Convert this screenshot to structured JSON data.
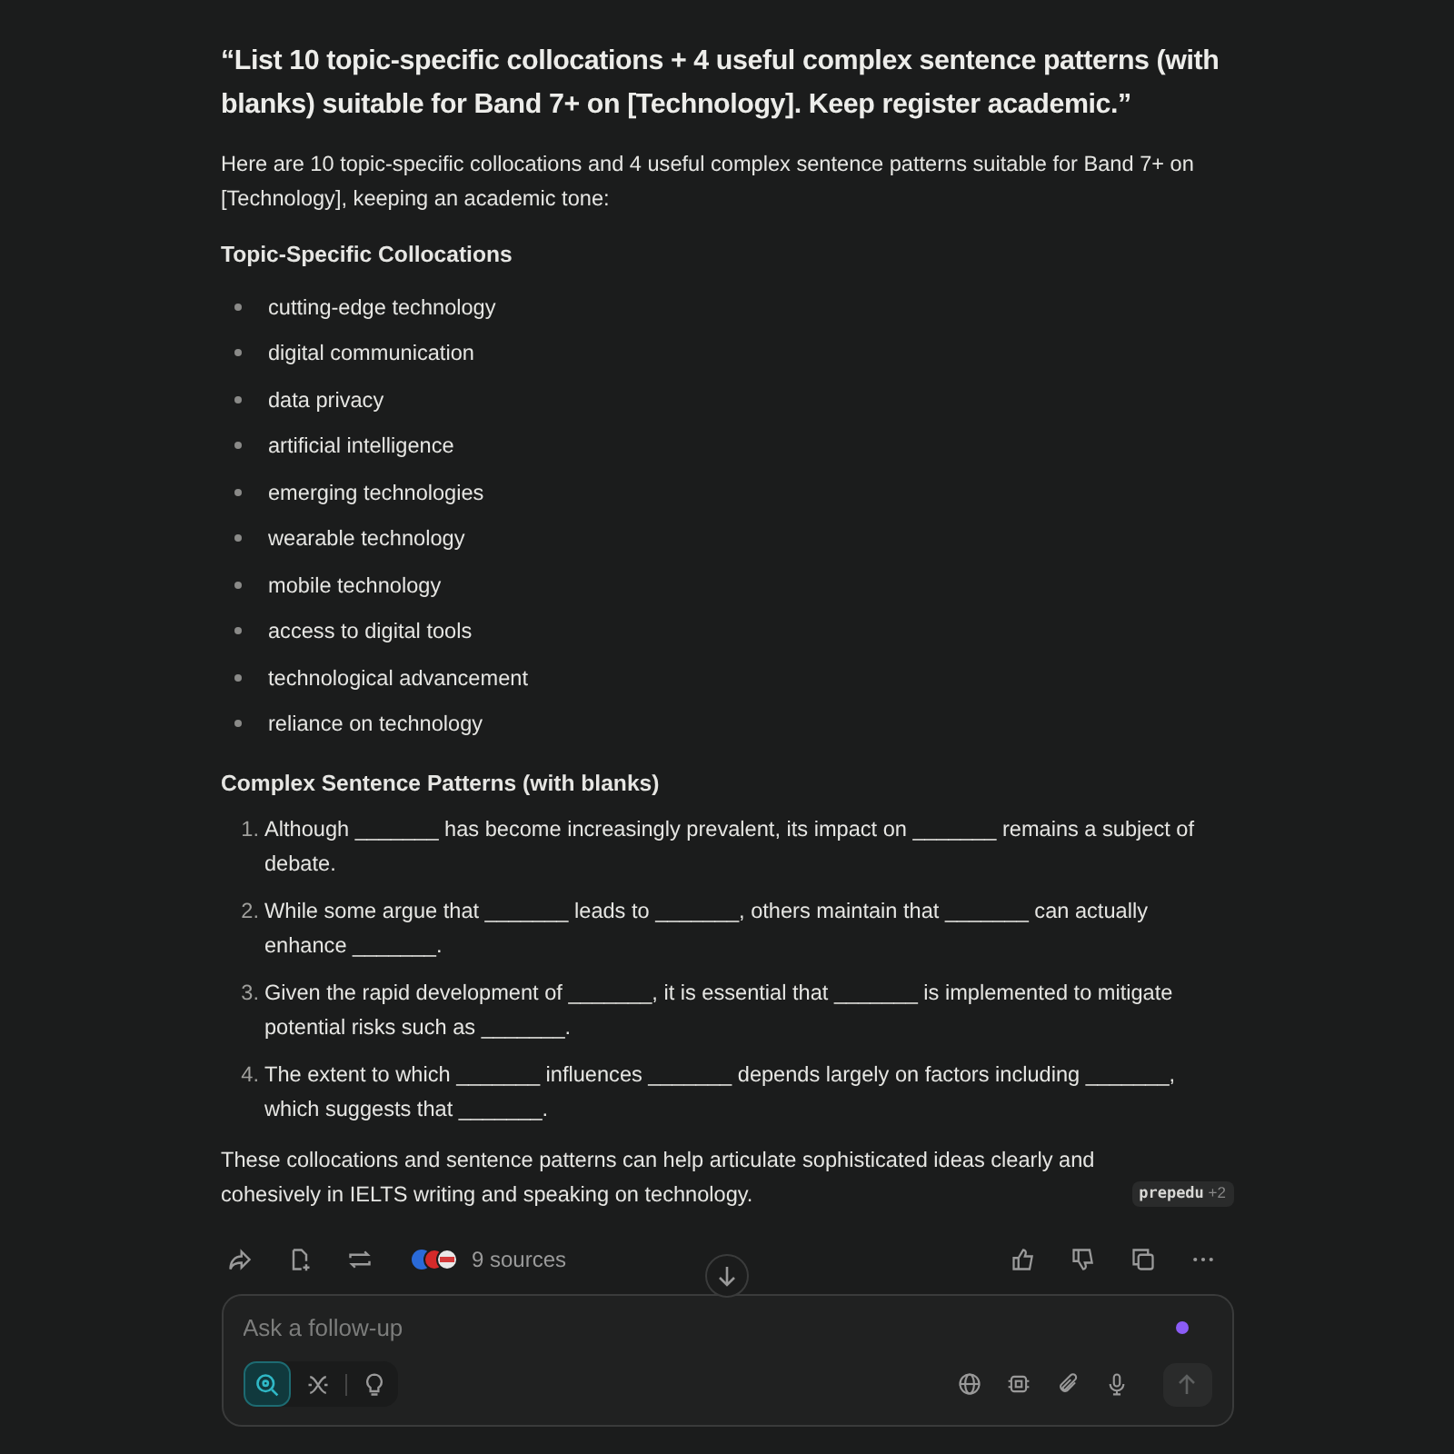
{
  "query": "“List 10 topic-specific collocations + 4 useful complex sentence patterns (with blanks) suitable for Band 7+ on [Technology]. Keep register academic.”",
  "intro": "Here are 10 topic-specific collocations and 4 useful complex sentence patterns suitable for Band 7+ on [Technology], keeping an academic tone:",
  "collocations_heading": "Topic-Specific Collocations",
  "collocations": [
    "cutting-edge technology",
    "digital communication",
    "data privacy",
    "artificial intelligence",
    "emerging technologies",
    "wearable technology",
    "mobile technology",
    "access to digital tools",
    "technological advancement",
    "reliance on technology"
  ],
  "patterns_heading": "Complex Sentence Patterns (with blanks)",
  "patterns": [
    {
      "number": "1.",
      "text": "Although _______ has become increasingly prevalent, its impact on _______ remains a subject of debate."
    },
    {
      "number": "2.",
      "text": "While some argue that _______ leads to _______, others maintain that _______ can actually enhance _______."
    },
    {
      "number": "3.",
      "text": "Given the rapid development of _______, it is essential that _______ is implemented to mitigate potential risks such as _______."
    },
    {
      "number": "4.",
      "text": "The extent to which _______ influences _______ depends largely on factors including _______, which suggests that _______."
    }
  ],
  "closing": {
    "text": "These collocations and sentence patterns can help articulate sophisticated ideas clearly and cohesively in IELTS writing and speaking on technology.",
    "citation": {
      "source": "prepedu",
      "more": "+2"
    }
  },
  "sources": "9 sources",
  "input": {
    "placeholder": "Ask a follow-up",
    "modes": [
      {
        "kind": "search",
        "selected": true
      },
      {
        "kind": "research",
        "selected": false
      },
      {
        "kind": "labs",
        "selected": false
      }
    ]
  }
}
